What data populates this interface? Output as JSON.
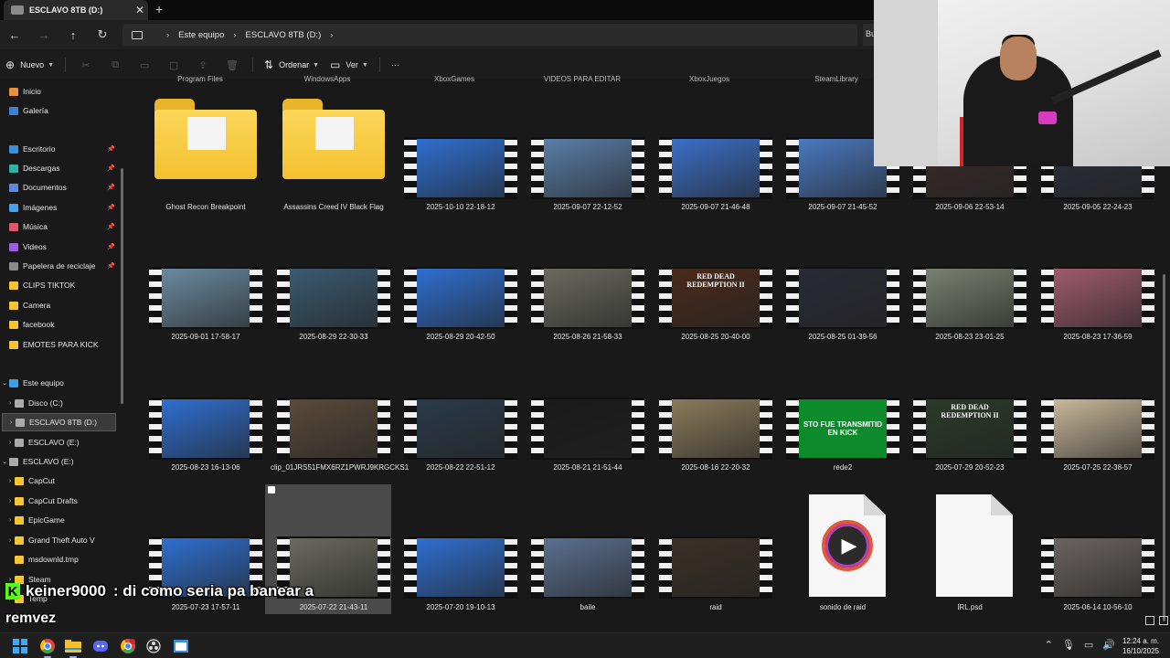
{
  "window": {
    "tab_title": "ESCLAVO 8TB (D:)",
    "close_glyph": "✕",
    "new_tab_glyph": "+"
  },
  "nav": {
    "back_glyph": "←",
    "forward_glyph": "→",
    "up_glyph": "↑",
    "refresh_glyph": "↻",
    "breadcrumb": [
      "Este equipo",
      "ESCLAVO 8TB (D:)"
    ],
    "search_stub": "Bu"
  },
  "command_bar": {
    "new_label": "Nuevo",
    "sort_label": "Ordenar",
    "view_label": "Ver",
    "more_glyph": "···"
  },
  "sidebar": {
    "quick": [
      {
        "label": "Inicio",
        "icon": "home-icon"
      },
      {
        "label": "Galería",
        "icon": "gallery-icon"
      }
    ],
    "pinned": [
      {
        "label": "Escritorio",
        "icon": "desktop-icon"
      },
      {
        "label": "Descargas",
        "icon": "downloads-icon"
      },
      {
        "label": "Documentos",
        "icon": "documents-icon"
      },
      {
        "label": "Imágenes",
        "icon": "pictures-icon"
      },
      {
        "label": "Música",
        "icon": "music-icon"
      },
      {
        "label": "Videos",
        "icon": "videos-icon"
      },
      {
        "label": "Papelera de reciclaje",
        "icon": "recycle-bin-icon"
      }
    ],
    "folders": [
      "CLIPS TIKTOK",
      "Camera",
      "facebook",
      "EMOTES PARA KICK"
    ],
    "this_pc": "Este equipo",
    "drives": [
      {
        "label": "Disco  (C:)"
      },
      {
        "label": "ESCLAVO 8TB (D:)",
        "selected": true
      },
      {
        "label": "ESCLAVO (E:)"
      }
    ],
    "drive_e_root": "ESCLAVO (E:)",
    "drive_e_children": [
      "CapCut",
      "CapCut Drafts",
      "EpicGame",
      "Grand Theft Auto V",
      "msdownld.tmp",
      "Steam",
      "Temp"
    ]
  },
  "content": {
    "partial_top_labels": [
      "Program Files",
      "WindowsApps",
      "XboxGames",
      "VIDEOS PARA EDITAR",
      "XboxJuegos",
      "SteamLibrary"
    ],
    "row1": [
      {
        "label": "Ghost Recon Breakpoint",
        "kind": "folder"
      },
      {
        "label": "Assassins Creed IV Black Flag",
        "kind": "folder"
      },
      {
        "label": "2025-10-10 22-18-12",
        "kind": "video",
        "tone": "#2f6fd0"
      },
      {
        "label": "2025-09-07 22-12-52",
        "kind": "video",
        "tone": "#5a7ea8"
      },
      {
        "label": "2025-09-07 21-46-48",
        "kind": "video",
        "tone": "#3b6fc8"
      },
      {
        "label": "2025-09-07 21-45-52",
        "kind": "video",
        "tone": "#4a78c0"
      },
      {
        "label": "2025-09-06 22-53-14",
        "kind": "video",
        "tone": "#3a2a2a"
      },
      {
        "label": "2025-09-05 22-24-23",
        "kind": "video",
        "tone": "#2a2f3a"
      }
    ],
    "row2": [
      {
        "label": "2025-09-01 17-58-17",
        "tone": "#6a8aa0"
      },
      {
        "label": "2025-08-29 22-30-33",
        "tone": "#3a5a70"
      },
      {
        "label": "2025-08-29 20-42-50",
        "tone": "#2f6fd0"
      },
      {
        "label": "2025-08-26 21-58-33",
        "tone": "#6a6a60"
      },
      {
        "label": "2025-08-25 20-40-00",
        "tone": "#4a2a1a"
      },
      {
        "label": "2025-08-25 01-39-56",
        "tone": "#2a2a35"
      },
      {
        "label": "2025-08-23 23-01-25",
        "tone": "#7a8070"
      },
      {
        "label": "2025-08-23 17-36-59",
        "tone": "#a05a70"
      }
    ],
    "row3": [
      {
        "label": "2025-08-23 16-13-06",
        "tone": "#2f6fd0"
      },
      {
        "label": "clip_01JRS51FMX6RZ1PWRJ9KRGCKS1",
        "tone": "#5a4a3a"
      },
      {
        "label": "2025-08-22 22-51-12",
        "tone": "#2a3a4a"
      },
      {
        "label": "2025-08-21 21-51-44",
        "tone": "#1a1a1a"
      },
      {
        "label": "2025-08-16 22-20-32",
        "tone": "#8a7a5a"
      },
      {
        "label": "rede2",
        "tone": "#1a9a3a"
      },
      {
        "label": "2025-07-29 20-52-23",
        "tone": "#2a3a2a"
      },
      {
        "label": "2025-07-25 22-38-57",
        "tone": "#c8b89a"
      }
    ],
    "row4": [
      {
        "label": "2025-07-23 17-57-11",
        "kind": "video",
        "tone": "#2f6fd0"
      },
      {
        "label": "2025-07-22 21-43-11",
        "kind": "video",
        "tone": "#6a6a60"
      },
      {
        "label": "2025-07-20 19-10-13",
        "kind": "video",
        "tone": "#2f6fd0"
      },
      {
        "label": "baile",
        "kind": "video",
        "tone": "#5a7090"
      },
      {
        "label": "raid",
        "kind": "video",
        "tone": "#3a3025"
      },
      {
        "label": "sonido de raid",
        "kind": "audio"
      },
      {
        "label": "IRL.psd",
        "kind": "file"
      },
      {
        "label": "2025-06-14 10-56-10",
        "kind": "video",
        "tone": "#6a6460"
      }
    ],
    "rede2_overlay": "STO FUE TRANSMITID EN KICK",
    "rdr_overlay": "RED DEAD REDEMPTION II"
  },
  "chat": {
    "badge": "K",
    "user": "keiner9000",
    "message": ": di como seria pa banear a"
  },
  "stream_brand": "remvez",
  "clock": {
    "time": "12:24 a. m.",
    "date": "16/10/2025"
  }
}
